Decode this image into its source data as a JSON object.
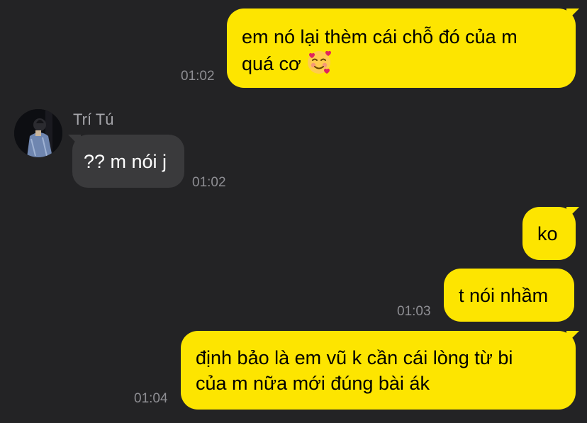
{
  "messages": [
    {
      "id": "m1",
      "direction": "outgoing",
      "lines": [
        "em nó lại thèm cái chỗ đó của m",
        "quá cơ"
      ],
      "emoji": "smiling-face-with-hearts",
      "time": "01:02"
    },
    {
      "id": "m2",
      "direction": "incoming",
      "sender": "Trí Tú",
      "text": "?? m nói j",
      "time": "01:02"
    },
    {
      "id": "m3",
      "direction": "outgoing",
      "text": "ko"
    },
    {
      "id": "m4",
      "direction": "outgoing",
      "text": "t nói nhầm",
      "time": "01:03"
    },
    {
      "id": "m5",
      "direction": "outgoing",
      "lines": [
        "định bảo là em vũ k cần cái lòng từ bi",
        "của m nữa mới đúng bài ák"
      ],
      "time": "01:04"
    }
  ],
  "colors": {
    "background": "#232325",
    "outgoing_bubble": "#FDE500",
    "incoming_bubble": "#3A3A3C",
    "timestamp": "#8e8e93"
  }
}
